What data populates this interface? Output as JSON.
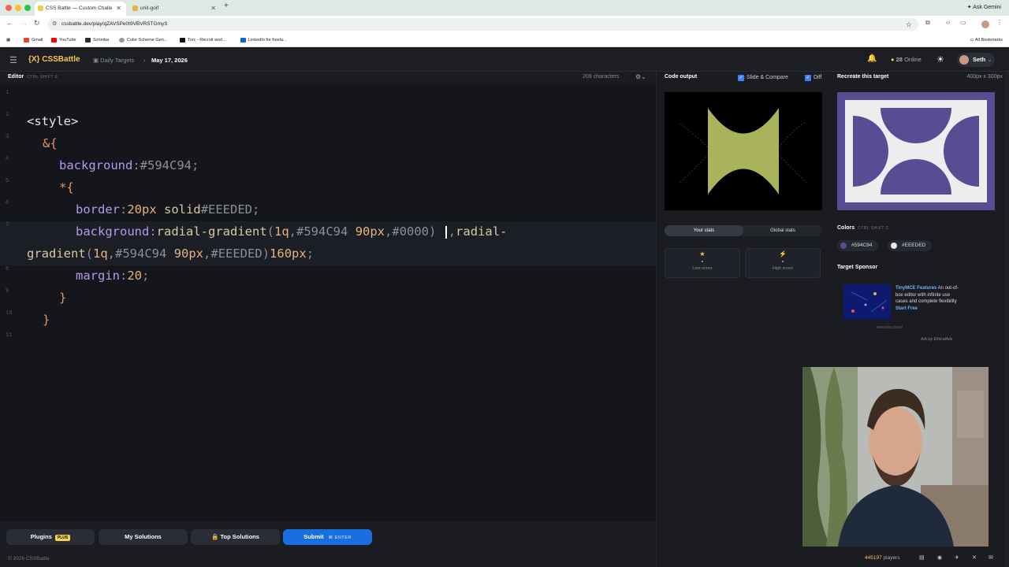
{
  "browser": {
    "tabs": [
      {
        "title": "CSS Battle — Custom Challe",
        "active": true
      },
      {
        "title": "unit-golf",
        "active": false
      }
    ],
    "ask_gemini": "Ask Gemini",
    "url": "cssbattle.dev/play/qZAVSPe0t9VBVRSTGmyS",
    "bookmarks": [
      "Gmail",
      "YouTube",
      "Scrimba",
      "Color Scheme Gen...",
      "Torc - Recruit worl...",
      "LinkedIn for freela..."
    ],
    "all_bookmarks": "All Bookmarks"
  },
  "app": {
    "logo": "{X} CSSBattle",
    "crumb_daily": "Daily Targets",
    "crumb_date": "May 17, 2026",
    "online_count": "28",
    "online_label": "Online",
    "user_name": "Seth"
  },
  "editor": {
    "label": "Editor",
    "shortcut": "CTRL SHIFT E",
    "characters": "209 characters",
    "line_numbers": [
      "1",
      "2",
      "3",
      "4",
      "5",
      "6",
      "7",
      "8",
      "9",
      "10",
      "11"
    ]
  },
  "code": {
    "l2": "<style>",
    "l3": "&{",
    "l4_prop": "background",
    "l4_val": "#594C94",
    "l5": "*{",
    "l6_prop": "border",
    "l6_num": "20px",
    "l6_kw": "solid",
    "l6_hex": "#EEEDED",
    "l7_prop": "background",
    "l7_fn": "radial-gradient",
    "l7_q": "1q",
    "l7_c1": "#594C94",
    "l7_px": "90px",
    "l7_c2": "#0000",
    "l7_fn2": "radial-",
    "l7b_fn": "gradient",
    "l7b_q": "1q",
    "l7b_c1": "#594C94",
    "l7b_px": "90px",
    "l7b_c2": "#EEEDED",
    "l7b_size": "160px",
    "l8_prop": "margin",
    "l8_val": "20",
    "l9": "}",
    "l10": "}"
  },
  "buttons": {
    "plugins": "Plugins",
    "plus_badge": "PLUS",
    "my_solutions": "My Solutions",
    "top_solutions": "Top Solutions",
    "submit": "Submit",
    "enter": "ENTER"
  },
  "footer": {
    "copyright": "© 2026 CSSBattle",
    "players_count": "445197",
    "players_label": "players"
  },
  "output": {
    "title": "Code output",
    "slide_compare": "Slide & Compare",
    "diff": "Diff",
    "tab_your_stats": "Your stats",
    "tab_global_stats": "Global stats",
    "last_score_value": "-",
    "last_score_label": "Last score",
    "high_score_value": "-",
    "high_score_label": "High score"
  },
  "target": {
    "title": "Recreate this target",
    "dims": "400px x 300px",
    "colors_label": "Colors",
    "colors_shortcut": "CTRL SHIFT C",
    "colors": [
      {
        "hex": "#594C94"
      },
      {
        "hex": "#EEEDED"
      }
    ],
    "sponsor_label": "Target Sponsor",
    "ad_title": "TinyMCE Features",
    "ad_body": "An out-of-box editor with infinite use cases and complete flexibility",
    "ad_cta": "Start Free",
    "ad_domain": "www.tiny.cloud",
    "ad_by": "Ads by EthicalAds"
  },
  "colors": {
    "purple": "#594C94",
    "light": "#EEEDED",
    "output_green": "#a8b35a",
    "accent_yellow": "#f5c74a",
    "submit_blue": "#1a6fe0"
  }
}
